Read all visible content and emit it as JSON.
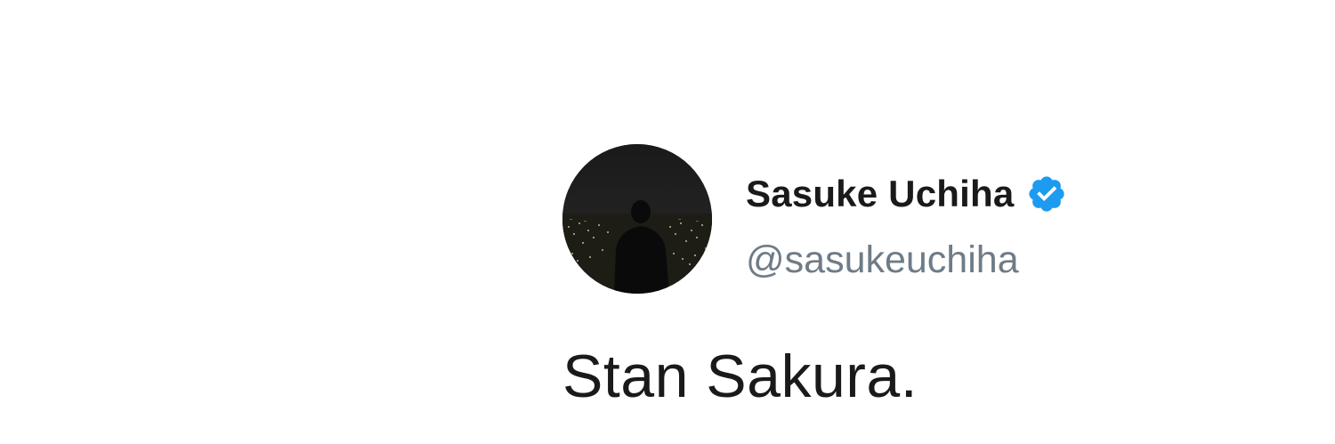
{
  "tweet": {
    "display_name": "Sasuke Uchiha",
    "handle": "@sasukeuchiha",
    "text": "Stan Sakura.",
    "verified": true,
    "verified_color": "#1d9bf0",
    "avatar_icon": "night-city-silhouette-avatar"
  }
}
